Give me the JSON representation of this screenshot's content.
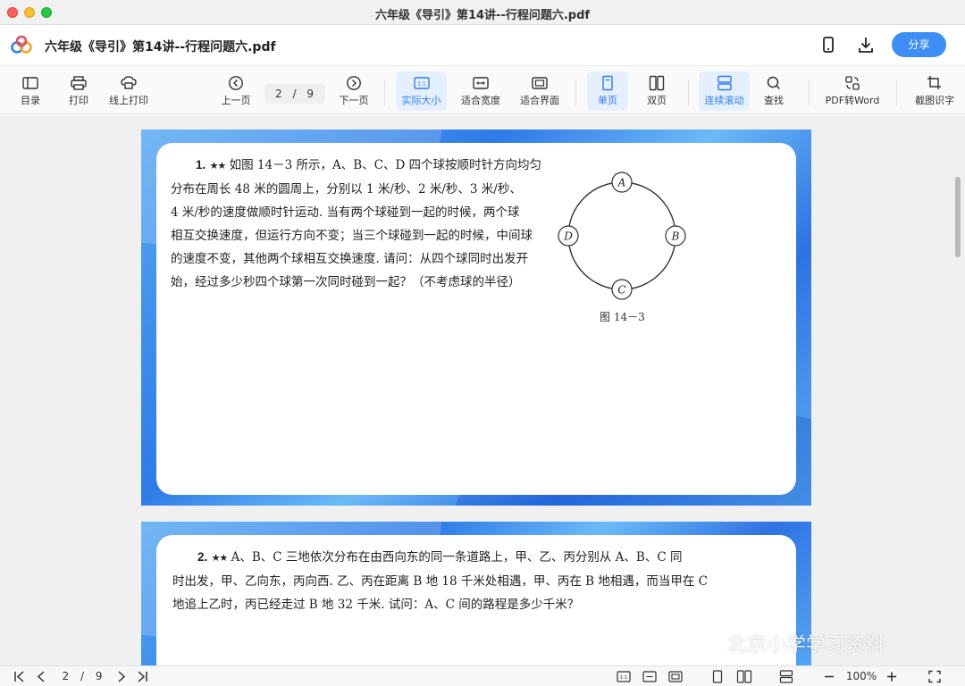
{
  "window": {
    "title": "六年级《导引》第14讲--行程问题六.pdf"
  },
  "header": {
    "doc_name": "六年级《导引》第14讲--行程问题六.pdf",
    "share_label": "分享"
  },
  "toolbar": {
    "toc": "目录",
    "print": "打印",
    "online_print": "线上打印",
    "prev_page": "上一页",
    "page_current": "2",
    "page_sep": "/",
    "page_total": "9",
    "next_page": "下一页",
    "actual_size": "实际大小",
    "fit_width": "适合宽度",
    "fit_page": "适合界面",
    "single_page": "单页",
    "double_page": "双页",
    "continuous_scroll": "连续滚动",
    "find": "查找",
    "pdf_to_word": "PDF转Word",
    "screenshot_ocr": "截图识字"
  },
  "pages": [
    {
      "number": "1.",
      "stars": "★★",
      "lines": [
        "如图 14－3 所示，A、B、C、D 四个球按顺时针方向均匀",
        "分布在周长 48 米的圆周上，分别以 1 米/秒、2 米/秒、3 米/秒、",
        "4 米/秒的速度做顺时针运动. 当有两个球碰到一起的时候，两个球",
        "相互交换速度，但运行方向不变；当三个球碰到一起的时候，中间球",
        "的速度不变，其他两个球相互交换速度. 请问：从四个球同时出发开",
        "始，经过多少秒四个球第一次同时碰到一起？（不考虑球的半径）"
      ],
      "figure": {
        "labels": [
          "A",
          "B",
          "C",
          "D"
        ],
        "caption": "图 14－3"
      }
    },
    {
      "number": "2.",
      "stars": "★★",
      "lines": [
        "A、B、C 三地依次分布在由西向东的同一条道路上，甲、乙、丙分别从 A、B、C 同",
        "时出发，甲、乙向东，丙向西. 乙、丙在距离 B 地 18 千米处相遇，甲、丙在 B 地相遇，而当甲在 C",
        "地追上乙时，丙已经走过 B 地 32 千米. 试问：A、C 间的路程是多少千米？"
      ]
    }
  ],
  "watermark": "北京小学学习资料",
  "bottombar": {
    "page_current": "2",
    "page_sep": "/",
    "page_total": "9",
    "zoom": "100%"
  },
  "colors": {
    "accent": "#3d8ef7",
    "active_bg": "#e4efff",
    "active_text": "#2f7cf6"
  }
}
